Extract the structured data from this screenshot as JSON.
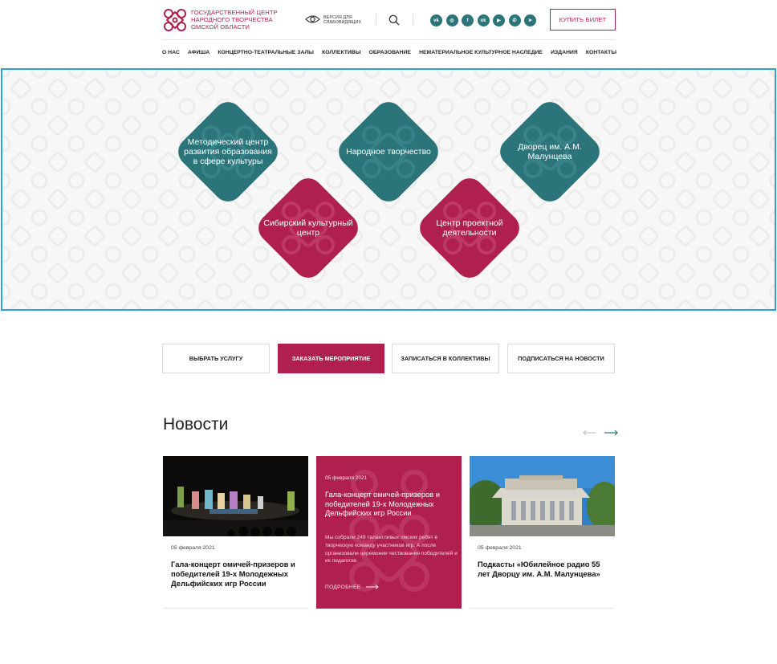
{
  "header": {
    "logo_lines": [
      "ГОСУДАРСТВЕННЫЙ ЦЕНТР",
      "НАРОДНОГО ТВОРЧЕСТВА",
      "ОМСКОЙ ОБЛАСТИ"
    ],
    "accessibility_lines": [
      "ВЕРСИЯ ДЛЯ",
      "СЛАБОВИДЯЩИХ"
    ],
    "socials": [
      {
        "icon": "vk-icon",
        "glyph": "vk"
      },
      {
        "icon": "instagram-icon",
        "glyph": "◎"
      },
      {
        "icon": "facebook-icon",
        "glyph": "f"
      },
      {
        "icon": "odnoklassniki-icon",
        "glyph": "ok"
      },
      {
        "icon": "youtube-icon",
        "glyph": "▶"
      },
      {
        "icon": "whatsapp-icon",
        "glyph": "✆"
      },
      {
        "icon": "telegram-icon",
        "glyph": "➤"
      }
    ],
    "buy_label": "КУПИТЬ БИЛЕТ"
  },
  "nav": [
    "О НАС",
    "АФИША",
    "КОНЦЕРТНО-ТЕАТРАЛЬНЫЕ ЗАЛЫ",
    "КОЛЛЕКТИВЫ",
    "ОБРАЗОВАНИЕ",
    "НЕМАТЕРИАЛЬНОЕ КУЛЬТУРНОЕ НАСЛЕДИЕ",
    "ИЗДАНИЯ",
    "КОНТАКТЫ"
  ],
  "tiles": [
    {
      "label": "Методический центр развития образования в сфере культуры",
      "color": "#2b7479"
    },
    {
      "label": "Народное творчество",
      "color": "#2b7479"
    },
    {
      "label": "Дворец им. А.М. Малунцева",
      "color": "#2b7479"
    },
    {
      "label": "Сибирский культурный центр",
      "color": "#b0204f"
    },
    {
      "label": "Центр проектной деятельности",
      "color": "#b0204f"
    }
  ],
  "actions": [
    {
      "label": "ВЫБРАТЬ УСЛУГУ"
    },
    {
      "label": "ЗАКАЗАТЬ МЕРОПРИЯТИЕ"
    },
    {
      "label": "ЗАПИСАТЬСЯ В КОЛЛЕКТИВЫ"
    },
    {
      "label": "ПОДПИСАТЬСЯ НА НОВОСТИ"
    }
  ],
  "news": {
    "title": "Новости",
    "cards": [
      {
        "date": "05 февраля 2021",
        "title": "Гала-концерт омичей-призеров и победителей 19-х Молодежных Дельфийских игр России"
      },
      {
        "date": "05 февраля 2021",
        "title": "Гала-концерт омичей-призеров и победителей 19-х Молодежных Дельфийских игр России",
        "text": "Мы собрали 249 талантливых омских ребят в творческую команду участников игр. А после организовали церемонии чествования победителей и их педагогов.",
        "more": "ПОДРОБНЕЕ"
      },
      {
        "date": "05 февраля 2021",
        "title": "Подкасты «Юбилейное радио 55 лет Дворцу им. А.М. Малунцева»"
      }
    ]
  },
  "colors": {
    "brand_red": "#b0204f",
    "brand_teal": "#2b7479"
  }
}
